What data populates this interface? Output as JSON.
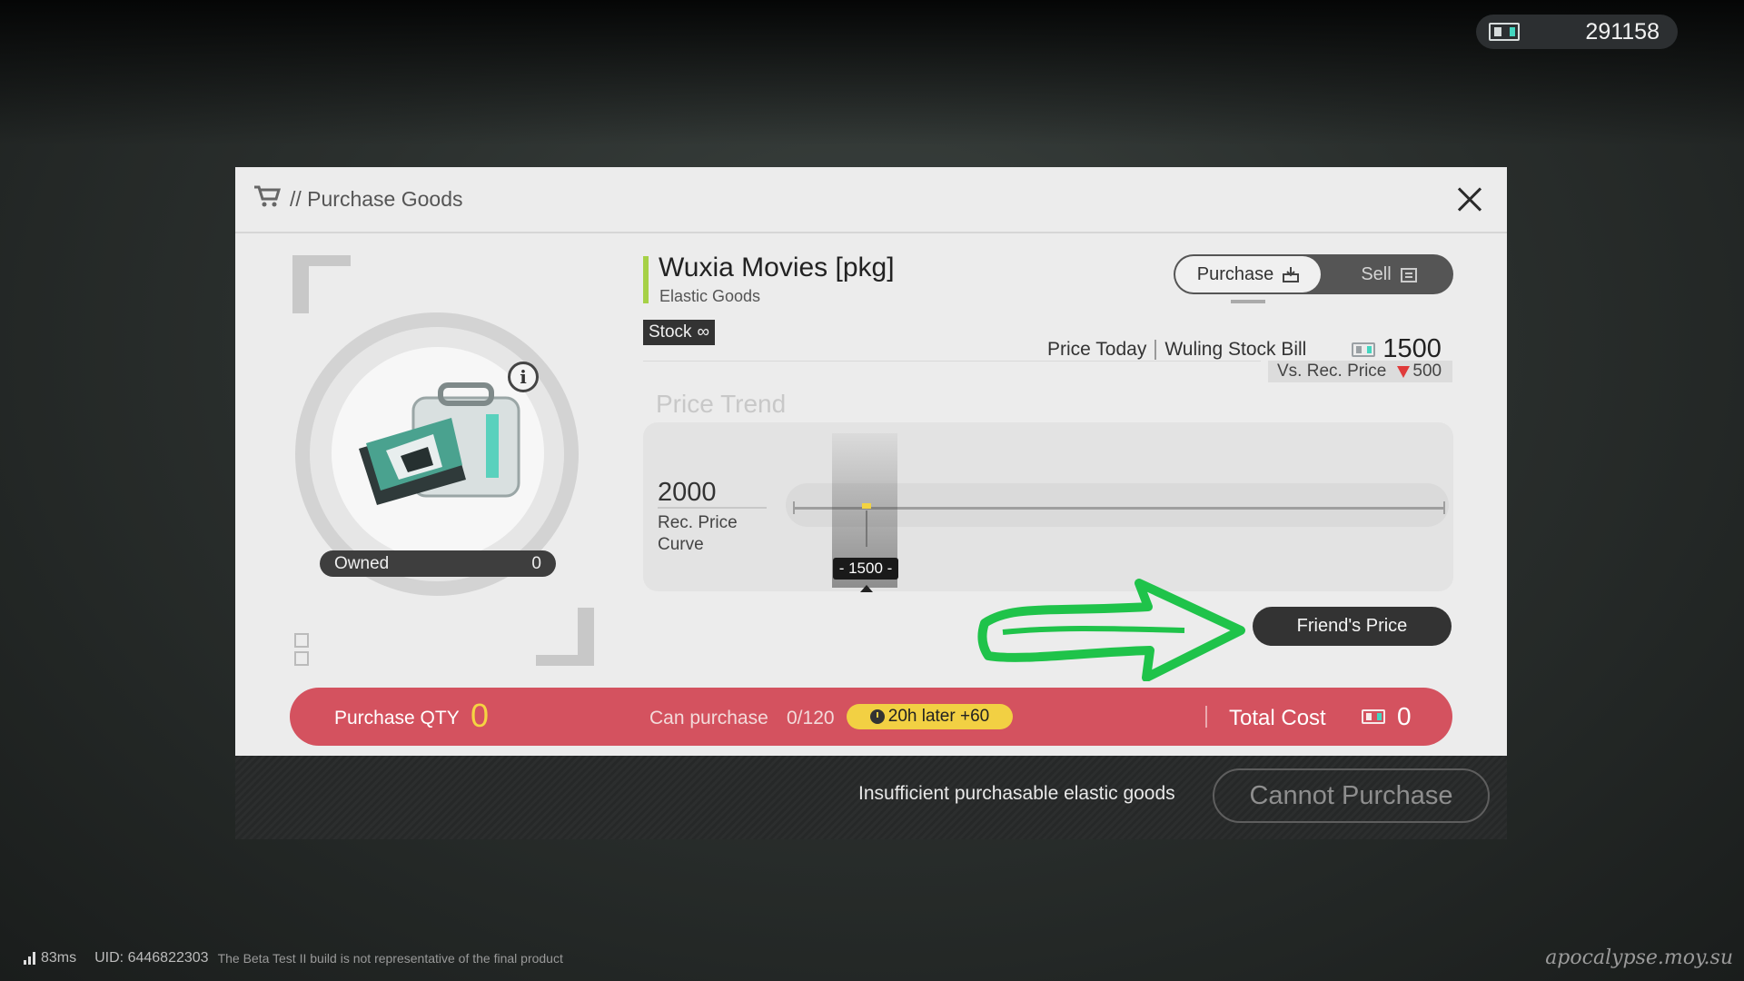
{
  "currency": {
    "icon": "wuling-stock-bill-icon",
    "value": "291158"
  },
  "dialog": {
    "title": "// Purchase Goods",
    "item": {
      "name": "Wuxia Movies [pkg]",
      "category": "Elastic Goods",
      "stock_label": "Stock",
      "stock_value": "∞",
      "owned_label": "Owned",
      "owned_value": "0"
    },
    "toggle": {
      "purchase": "Purchase",
      "sell": "Sell",
      "active": "purchase"
    },
    "price": {
      "today_label": "Price Today",
      "currency_name": "Wuling Stock Bill",
      "today_value": "1500",
      "vs_label": "Vs. Rec. Price",
      "vs_value": "500",
      "vs_direction": "down"
    },
    "trend": {
      "title": "Price Trend",
      "rec_value": "2000",
      "rec_label": "Rec. Price Curve",
      "current_marker": "- 1500 -"
    },
    "friend_button": "Friend's Price",
    "qty": {
      "label": "Purchase QTY",
      "value": "0",
      "can_label": "Can purchase",
      "can_value": "0/120",
      "refresh": "20h later +60",
      "total_label": "Total Cost",
      "total_value": "0"
    },
    "footer": {
      "message": "Insufficient purchasable elastic goods",
      "button": "Cannot Purchase"
    }
  },
  "status": {
    "ping": "83ms",
    "uid": "UID: 6446822303",
    "notice": "The Beta Test II build is not representative of the final product"
  },
  "watermark": "apocalypse.moy.su",
  "colors": {
    "accent_green": "#a6d146",
    "qty_bar": "#d4525f",
    "highlight_yellow": "#f5d442",
    "annotation_arrow": "#1fc34a"
  }
}
